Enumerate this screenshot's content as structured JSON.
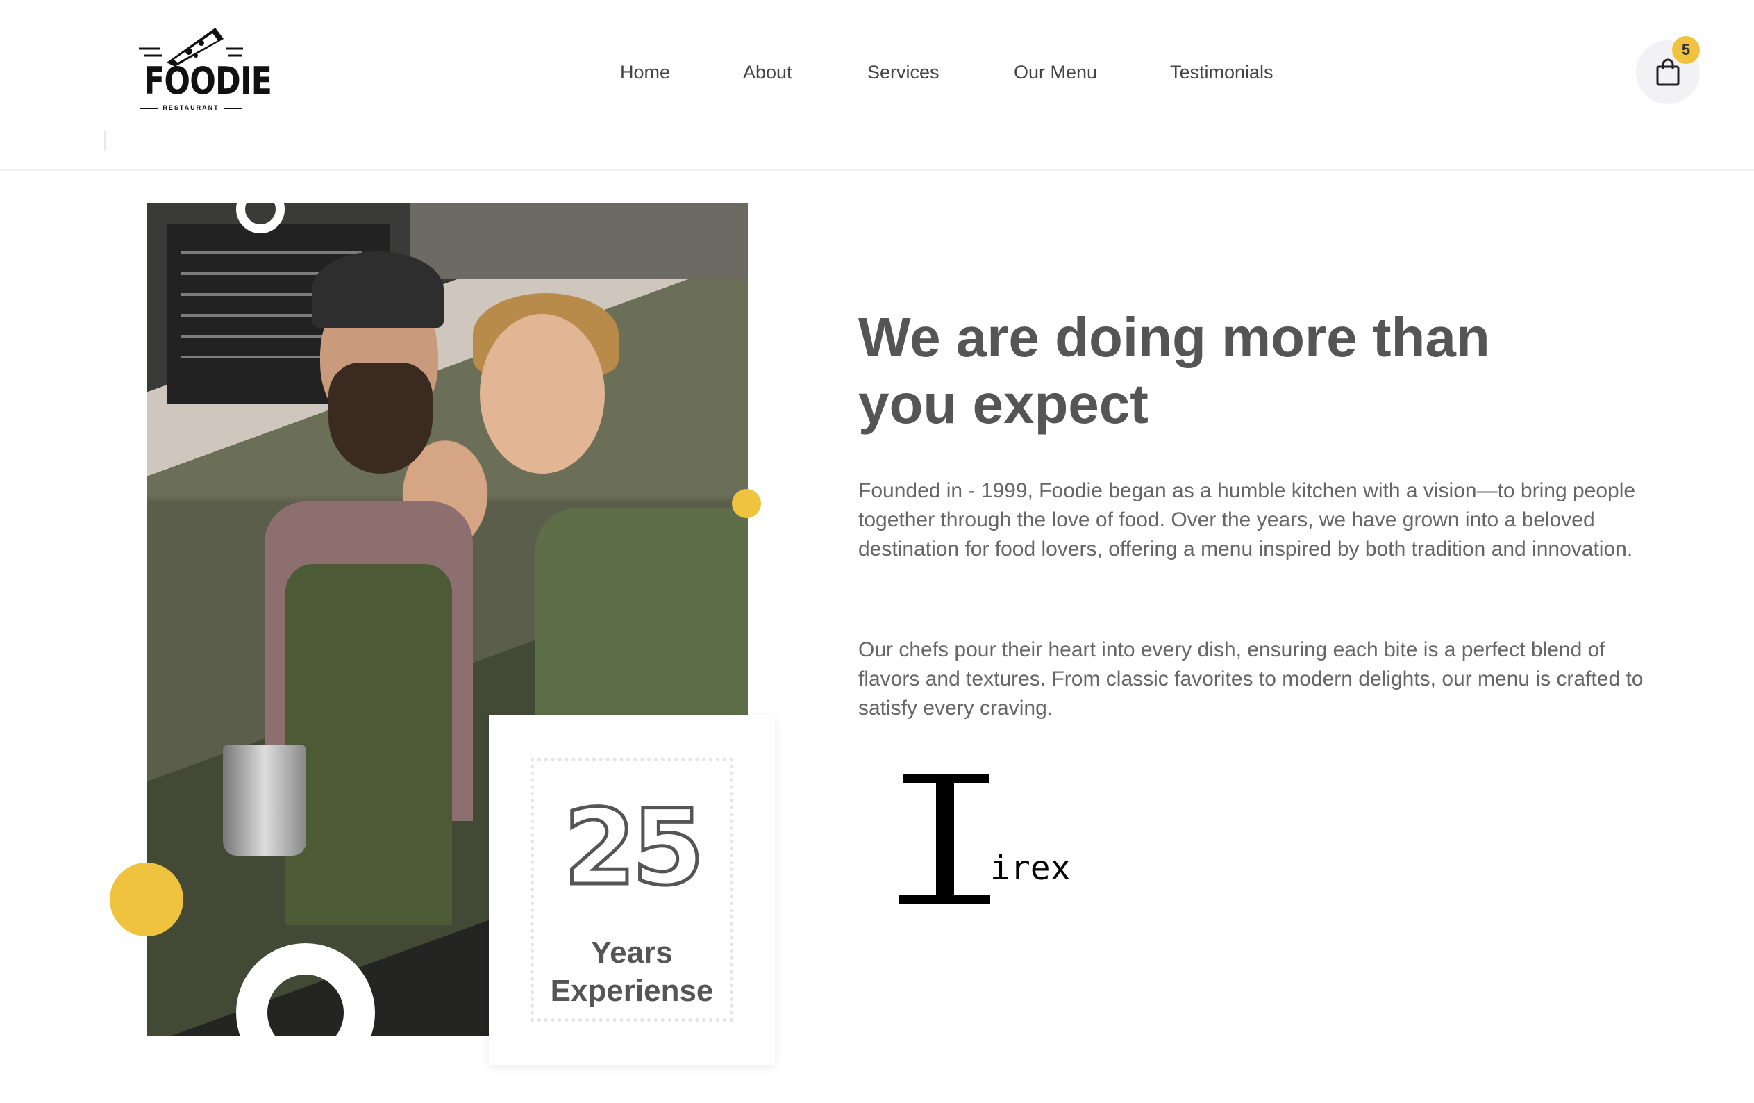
{
  "header": {
    "logo_text": "FOODIE",
    "logo_subtext": "RESTAURANT",
    "nav": [
      {
        "label": "Home"
      },
      {
        "label": "About"
      },
      {
        "label": "Services"
      },
      {
        "label": "Our Menu"
      },
      {
        "label": "Testimonials"
      }
    ],
    "cart_count": "5",
    "cart_icon": "shopping-bag-icon"
  },
  "about": {
    "heading_line1": "We are doing more than",
    "heading_line2": "you expect",
    "paragraph1": "Founded in - 1999, Foodie began as a humble kitchen with a vision—to bring people together through the love of food. Over the years, we have grown into a beloved destination for food lovers, offering a menu inspired by both tradition and innovation.",
    "paragraph2": "Our chefs pour their heart into every dish, ensuring each bite is a perfect blend of flavors and textures. From classic favorites to modern delights, our menu is crafted to satisfy every craving.",
    "experience_number": "25",
    "experience_label_line1": "Years",
    "experience_label_line2": "Experiense",
    "signature_text": "irex"
  },
  "colors": {
    "accent": "#efc33d",
    "text": "#555555",
    "background": "#ffffff"
  }
}
